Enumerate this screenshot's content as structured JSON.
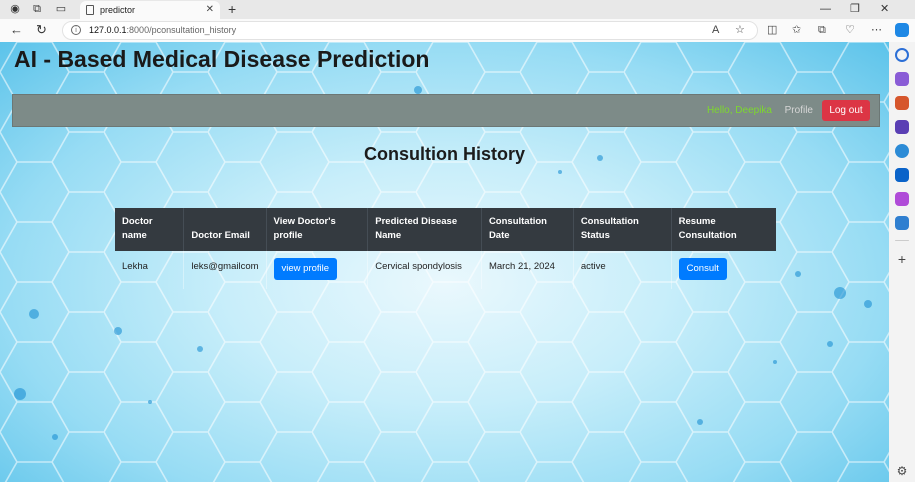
{
  "browser": {
    "tab_title": "predictor",
    "url_host": "127.0.0.1",
    "url_path": ":8000/pconsultation_history"
  },
  "site": {
    "title": "AI - Based Medical Disease Prediction"
  },
  "navbar": {
    "greeting": "Hello, Deepika",
    "profile_label": "Profile",
    "logout_label": "Log out"
  },
  "page": {
    "heading": "Consultion History"
  },
  "table": {
    "headers": {
      "doctor_name": "Doctor name",
      "doctor_email": "Doctor Email",
      "view_profile": "View Doctor's profile",
      "disease": "Predicted Disease Name",
      "date": "Consultation Date",
      "status": "Consultation Status",
      "resume": "Resume Consultation"
    },
    "rows": [
      {
        "doctor_name": "Lekha",
        "doctor_email": "leks@gmailcom",
        "view_profile_label": "view profile",
        "disease": "Cervical spondylosis",
        "date": "March 21, 2024",
        "status": "active",
        "consult_label": "Consult"
      }
    ]
  },
  "colors": {
    "navbar": "#7d8b88",
    "logout": "#dc3545",
    "primary_button": "#007bff",
    "table_header": "#343a40",
    "greeting": "#7dd82e"
  }
}
